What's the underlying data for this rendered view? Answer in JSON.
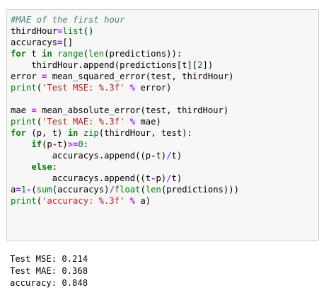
{
  "code_cell": {
    "lines": [
      [
        {
          "t": "comment",
          "s": "#MAE of the first hour"
        }
      ],
      [
        {
          "t": "plain",
          "s": "thirdHour"
        },
        {
          "t": "operator",
          "s": "="
        },
        {
          "t": "builtin",
          "s": "list"
        },
        {
          "t": "plain",
          "s": "()"
        }
      ],
      [
        {
          "t": "plain",
          "s": "accuracys"
        },
        {
          "t": "operator",
          "s": "="
        },
        {
          "t": "plain",
          "s": "[]"
        }
      ],
      [
        {
          "t": "keyword",
          "s": "for"
        },
        {
          "t": "plain",
          "s": " t "
        },
        {
          "t": "keyword",
          "s": "in"
        },
        {
          "t": "plain",
          "s": " "
        },
        {
          "t": "builtin",
          "s": "range"
        },
        {
          "t": "plain",
          "s": "("
        },
        {
          "t": "builtin",
          "s": "len"
        },
        {
          "t": "plain",
          "s": "(predictions)):"
        }
      ],
      [
        {
          "t": "plain",
          "s": "    thirdHour.append(predictions[t]["
        },
        {
          "t": "number",
          "s": "2"
        },
        {
          "t": "plain",
          "s": "])"
        }
      ],
      [
        {
          "t": "plain",
          "s": "error "
        },
        {
          "t": "operator",
          "s": "="
        },
        {
          "t": "plain",
          "s": " mean_squared_error(test, thirdHour)"
        }
      ],
      [
        {
          "t": "builtin",
          "s": "print"
        },
        {
          "t": "plain",
          "s": "("
        },
        {
          "t": "string",
          "s": "'Test MSE: %.3f'"
        },
        {
          "t": "plain",
          "s": " "
        },
        {
          "t": "operator",
          "s": "%"
        },
        {
          "t": "plain",
          "s": " error)"
        }
      ],
      [],
      [
        {
          "t": "plain",
          "s": "mae "
        },
        {
          "t": "operator",
          "s": "="
        },
        {
          "t": "plain",
          "s": " mean_absolute_error(test, thirdHour)"
        }
      ],
      [
        {
          "t": "builtin",
          "s": "print"
        },
        {
          "t": "plain",
          "s": "("
        },
        {
          "t": "string",
          "s": "'Test MAE: %.3f'"
        },
        {
          "t": "plain",
          "s": " "
        },
        {
          "t": "operator",
          "s": "%"
        },
        {
          "t": "plain",
          "s": " mae)"
        }
      ],
      [
        {
          "t": "keyword",
          "s": "for"
        },
        {
          "t": "plain",
          "s": " (p, t) "
        },
        {
          "t": "keyword",
          "s": "in"
        },
        {
          "t": "plain",
          "s": " "
        },
        {
          "t": "builtin",
          "s": "zip"
        },
        {
          "t": "plain",
          "s": "(thirdHour, test):"
        }
      ],
      [
        {
          "t": "plain",
          "s": "    "
        },
        {
          "t": "keyword",
          "s": "if"
        },
        {
          "t": "plain",
          "s": "(p"
        },
        {
          "t": "operator",
          "s": "-"
        },
        {
          "t": "plain",
          "s": "t)"
        },
        {
          "t": "operator",
          "s": ">="
        },
        {
          "t": "number",
          "s": "0"
        },
        {
          "t": "plain",
          "s": ":"
        }
      ],
      [
        {
          "t": "plain",
          "s": "        accuracys.append((p"
        },
        {
          "t": "operator",
          "s": "-"
        },
        {
          "t": "plain",
          "s": "t)"
        },
        {
          "t": "operator",
          "s": "/"
        },
        {
          "t": "plain",
          "s": "t)"
        }
      ],
      [
        {
          "t": "plain",
          "s": "    "
        },
        {
          "t": "keyword",
          "s": "else"
        },
        {
          "t": "plain",
          "s": ":"
        }
      ],
      [
        {
          "t": "plain",
          "s": "        accuracys.append((t"
        },
        {
          "t": "operator",
          "s": "-"
        },
        {
          "t": "plain",
          "s": "p)"
        },
        {
          "t": "operator",
          "s": "/"
        },
        {
          "t": "plain",
          "s": "t)"
        }
      ],
      [
        {
          "t": "plain",
          "s": "a"
        },
        {
          "t": "operator",
          "s": "="
        },
        {
          "t": "number",
          "s": "1"
        },
        {
          "t": "operator",
          "s": "-"
        },
        {
          "t": "plain",
          "s": "("
        },
        {
          "t": "builtin",
          "s": "sum"
        },
        {
          "t": "plain",
          "s": "(accuracys)"
        },
        {
          "t": "operator",
          "s": "/"
        },
        {
          "t": "builtin",
          "s": "float"
        },
        {
          "t": "plain",
          "s": "("
        },
        {
          "t": "builtin",
          "s": "len"
        },
        {
          "t": "plain",
          "s": "(predictions)))"
        }
      ],
      [
        {
          "t": "builtin",
          "s": "print"
        },
        {
          "t": "plain",
          "s": "("
        },
        {
          "t": "string",
          "s": "'accuracy: %.3f'"
        },
        {
          "t": "plain",
          "s": " "
        },
        {
          "t": "operator",
          "s": "%"
        },
        {
          "t": "plain",
          "s": " a)"
        }
      ]
    ]
  },
  "output": {
    "lines": [
      "Test MSE: 0.214",
      "Test MAE: 0.368",
      "accuracy: 0.848"
    ]
  },
  "colors": {
    "cell_background": "#f7f7f7",
    "cell_border": "#cfcfcf",
    "comment": "#408080",
    "keyword": "#008000",
    "builtin": "#008000",
    "operator": "#aa22ff",
    "string": "#ba2121",
    "number": "#008000"
  }
}
